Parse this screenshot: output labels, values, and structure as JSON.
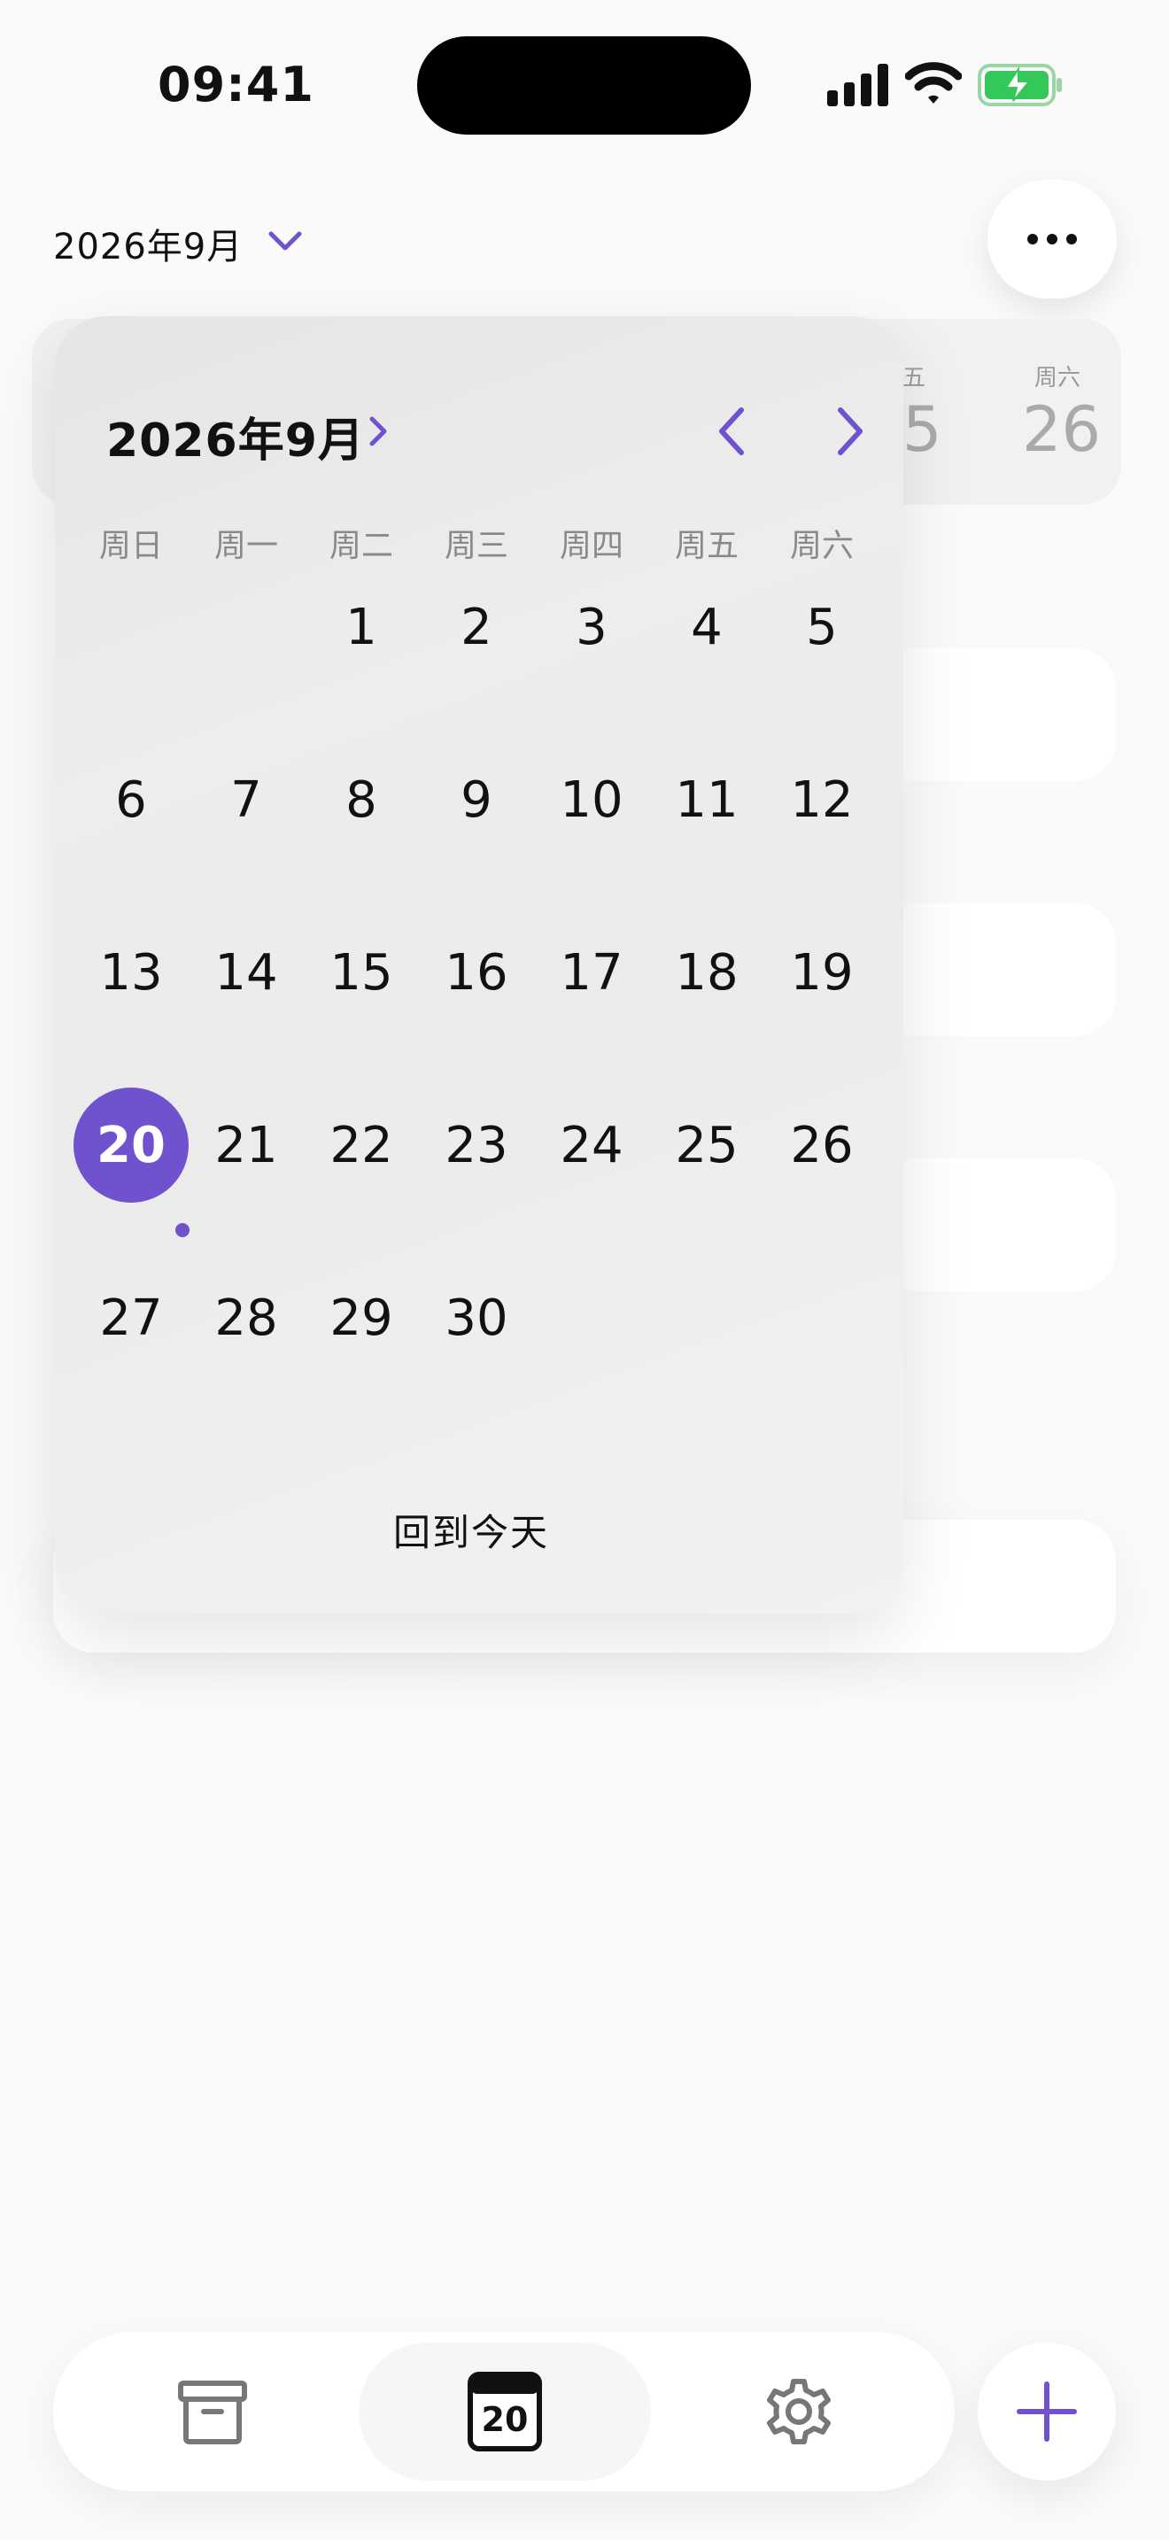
{
  "status": {
    "time": "09:41",
    "battery_color": "#34c759"
  },
  "header": {
    "month": "2026年9月",
    "chevron_icon": "chevron-down-icon",
    "more_icon": "ellipsis-icon"
  },
  "week_strip": {
    "partial_day_label": "五",
    "partial_day_num": "5",
    "last_day_label": "周六",
    "last_day_num": "26"
  },
  "calendar": {
    "title": "2026年9月",
    "weekdays": [
      "周日",
      "周一",
      "周二",
      "周三",
      "周四",
      "周五",
      "周六"
    ],
    "days": [
      "1",
      "2",
      "3",
      "4",
      "5",
      "6",
      "7",
      "8",
      "9",
      "10",
      "11",
      "12",
      "13",
      "14",
      "15",
      "16",
      "17",
      "18",
      "19",
      "20",
      "21",
      "22",
      "23",
      "24",
      "25",
      "26",
      "27",
      "28",
      "29",
      "30"
    ],
    "first_weekday_index": 2,
    "selected_day": "20",
    "today_button": "回到今天",
    "accent": "#7052cf"
  },
  "tabbar": {
    "tabs": [
      {
        "name": "archive-tab",
        "icon": "archive-box-icon"
      },
      {
        "name": "calendar-tab",
        "icon": "calendar-icon",
        "day": "20",
        "active": true
      },
      {
        "name": "settings-tab",
        "icon": "gear-icon"
      }
    ],
    "add_icon": "plus-icon"
  }
}
